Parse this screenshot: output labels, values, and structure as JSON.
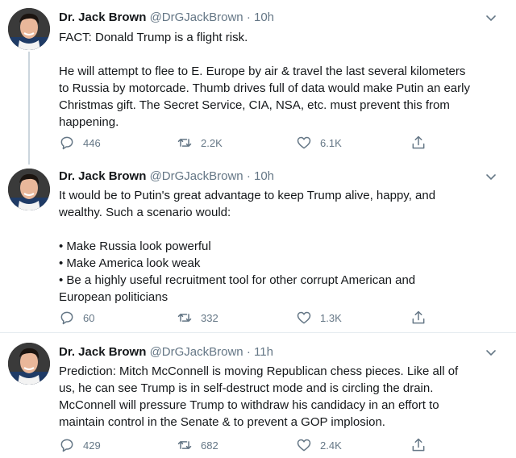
{
  "tweets": [
    {
      "name": "Dr. Jack Brown",
      "handle": "@DrGJackBrown",
      "time_sep": "·",
      "time": "10h",
      "lines": [
        "FACT: Donald Trump is a flight risk.",
        "",
        "He will attempt to flee to E. Europe by air & travel the last several kilometers",
        "to Russia by motorcade. Thumb drives full of data would make Putin an early",
        "Christmas gift. The Secret Service, CIA, NSA, etc. must prevent this from",
        "happening."
      ],
      "replies": "446",
      "retweets": "2.2K",
      "likes": "6.1K"
    },
    {
      "name": "Dr. Jack Brown",
      "handle": "@DrGJackBrown",
      "time_sep": "·",
      "time": "10h",
      "lines": [
        "It would be to Putin's great advantage to keep Trump alive, happy, and",
        "wealthy. Such a scenario would:",
        "",
        "• Make Russia look powerful",
        "• Make America look weak",
        "• Be a highly useful recruitment tool for other corrupt American and",
        "European politicians"
      ],
      "replies": "60",
      "retweets": "332",
      "likes": "1.3K"
    },
    {
      "name": "Dr. Jack Brown",
      "handle": "@DrGJackBrown",
      "time_sep": "·",
      "time": "11h",
      "lines": [
        "Prediction: Mitch McConnell is moving Republican chess pieces. Like all of",
        "us, he can see Trump is in self-destruct mode and is circling the drain.",
        "McConnell will pressure Trump to withdraw his candidacy in an effort to",
        "maintain control in the Senate & to prevent a GOP implosion."
      ],
      "replies": "429",
      "retweets": "682",
      "likes": "2.4K"
    }
  ],
  "icons": {
    "reply": "reply-icon",
    "retweet": "retweet-icon",
    "like": "like-icon",
    "share": "share-icon",
    "caret": "chevron-down-icon"
  },
  "colors": {
    "text": "#14171a",
    "muted": "#657786",
    "divider": "#e6ecf0",
    "thread_line": "#ccd6dd"
  }
}
